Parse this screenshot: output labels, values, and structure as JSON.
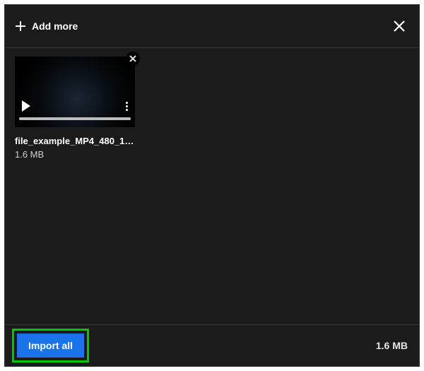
{
  "header": {
    "add_more_label": "Add more"
  },
  "files": [
    {
      "name": "file_example_MP4_480_1…",
      "size": "1.6 MB"
    }
  ],
  "footer": {
    "import_label": "Import all",
    "total_size": "1.6 MB"
  },
  "colors": {
    "accent": "#1a73e8",
    "highlight_border": "#00c800"
  }
}
